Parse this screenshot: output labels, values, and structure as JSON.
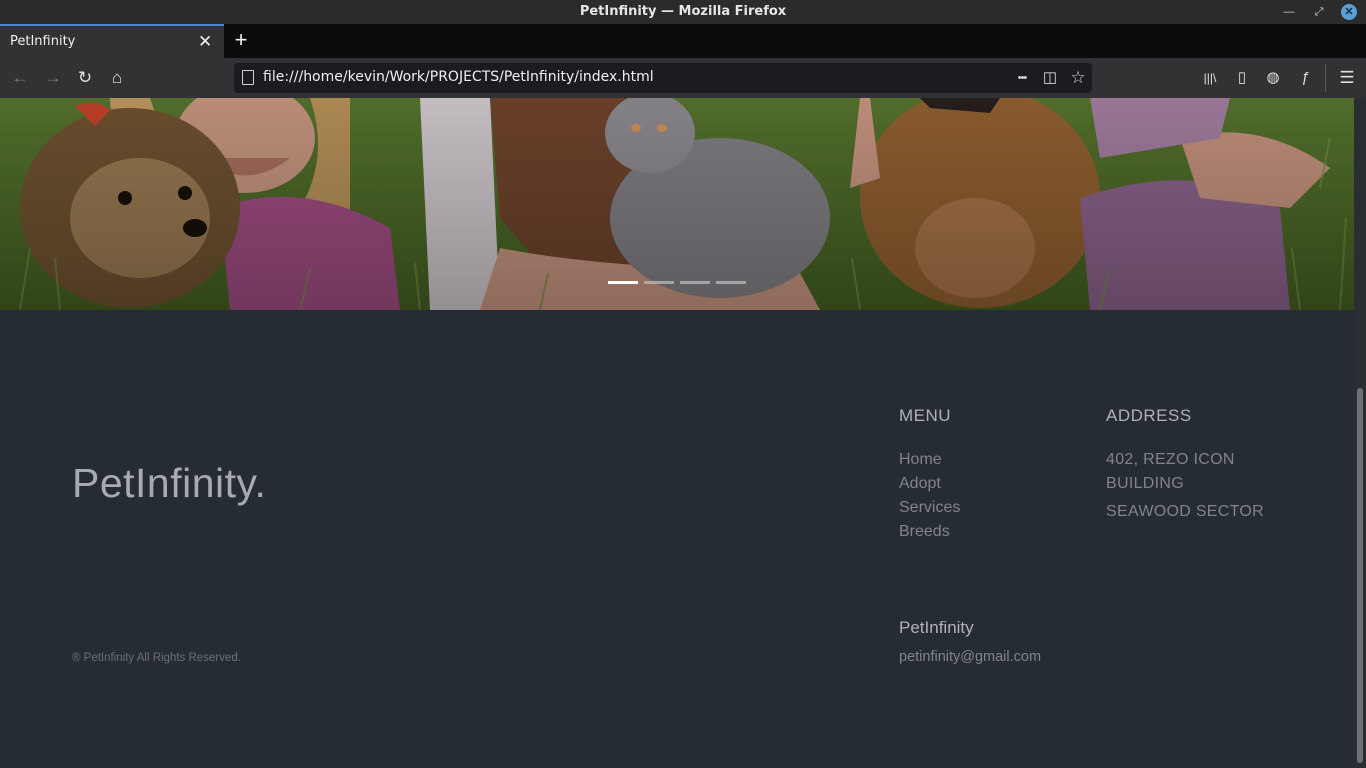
{
  "window": {
    "title": "PetInfinity — Mozilla Firefox"
  },
  "tabs": [
    {
      "label": "PetInfinity",
      "close": "✕"
    }
  ],
  "newtab": {
    "label": "+"
  },
  "navbar": {
    "url": "file:///home/kevin/Work/PROJECTS/PetInfinity/index.html",
    "back": "←",
    "forward": "→",
    "reload": "↻",
    "home": "⌂",
    "more": "•••",
    "pocket": "◫",
    "bookmark": "☆",
    "library": "|||\\",
    "sidebar": "▯",
    "globe": "◍",
    "extension": "ƒ",
    "menu": "☰"
  },
  "carousel": {
    "slides": 4,
    "active_index": 0
  },
  "footer": {
    "brand": "PetInfinity.",
    "copyright": "® PetInfinity All Rights Reserved.",
    "menu": {
      "title": "MENU",
      "items": [
        "Home",
        "Adopt",
        "Services",
        "Breeds"
      ]
    },
    "address": {
      "title": "ADDRESS",
      "line1": "402, REZO ICON",
      "line2": "BUILDING",
      "line3": "SEAWOOD SECTOR"
    },
    "contact": {
      "name": "PetInfinity",
      "email": "petinfinity@gmail.com"
    }
  },
  "colors": {
    "footer_bg": "#262c33",
    "tab_accent": "#4d7cfe"
  }
}
